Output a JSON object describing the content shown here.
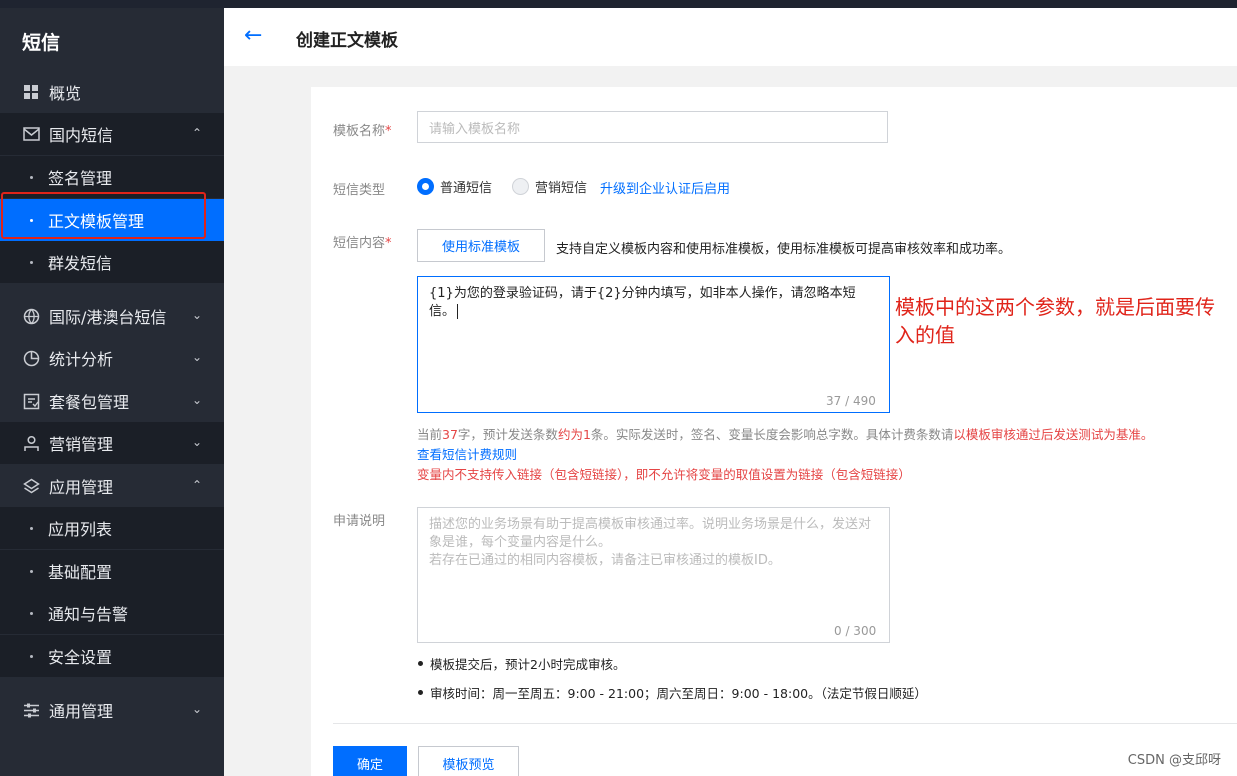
{
  "sidebar": {
    "title": "短信",
    "items": [
      {
        "label": "概览",
        "icon": "grid-icon"
      },
      {
        "label": "国内短信",
        "icon": "mail-icon",
        "expanded": true
      },
      {
        "label": "签名管理"
      },
      {
        "label": "正文模板管理",
        "active": true
      },
      {
        "label": "群发短信"
      },
      {
        "label": "国际/港澳台短信",
        "icon": "globe-icon"
      },
      {
        "label": "统计分析",
        "icon": "pie-chart-icon"
      },
      {
        "label": "套餐包管理",
        "icon": "package-icon"
      },
      {
        "label": "营销管理",
        "icon": "people-icon"
      },
      {
        "label": "应用管理",
        "icon": "layers-icon",
        "expanded": true
      },
      {
        "label": "应用列表"
      },
      {
        "label": "基础配置"
      },
      {
        "label": "通知与告警"
      },
      {
        "label": "安全设置"
      },
      {
        "label": "通用管理",
        "icon": "sliders-icon"
      }
    ]
  },
  "header": {
    "title": "创建正文模板"
  },
  "form": {
    "name_label": "模板名称",
    "required_mark": "*",
    "name_placeholder": "请输入模板名称",
    "type_label": "短信类型",
    "type_options": [
      "普通短信",
      "营销短信"
    ],
    "type_selected": "普通短信",
    "upgrade_link": "升级到企业认证后启用",
    "content_label": "短信内容",
    "use_standard_button": "使用标准模板",
    "standard_hint": "支持自定义模板内容和使用标准模板，使用标准模板可提高审核效率和成功率。",
    "content_value": "{1}为您的登录验证码，请于{2}分钟内填写，如非本人操作，请忽略本短信。",
    "content_counter": "37 / 490",
    "annotation": "模板中的这两个参数，就是后面要传入的值",
    "count_hint": {
      "p1": "当前",
      "chars": "37",
      "p2": "字，预计发送条数",
      "est": "约为1",
      "p3": "条。实际发送时，签名、变量长度会影响总字数。具体计费条数请",
      "p4": "以模板审核通过后发送测试为基准。"
    },
    "billing_link": "查看短信计费规则",
    "link_warning": "变量内不支持传入链接（包含短链接），即不允许将变量的取值设置为链接（包含短链接）",
    "apply_label": "申请说明",
    "apply_placeholder": "描述您的业务场景有助于提高模板审核通过率。说明业务场景是什么，发送对象是谁，每个变量内容是什么。\n若存在已通过的相同内容模板，请备注已审核通过的模板ID。",
    "apply_counter": "0 / 300",
    "note1": "模板提交后，预计2小时完成审核。",
    "note2": "审核时间：周一至周五：9:00 - 21:00；周六至周日：9:00 - 18:00。（法定节假日顺延）",
    "confirm_button": "确定",
    "preview_button": "模板预览"
  },
  "watermark": "CSDN @支邱呀",
  "colors": {
    "accent": "#006eff",
    "sidebar": "#262b35",
    "warning": "#e54545",
    "annotation": "#e0241a"
  }
}
